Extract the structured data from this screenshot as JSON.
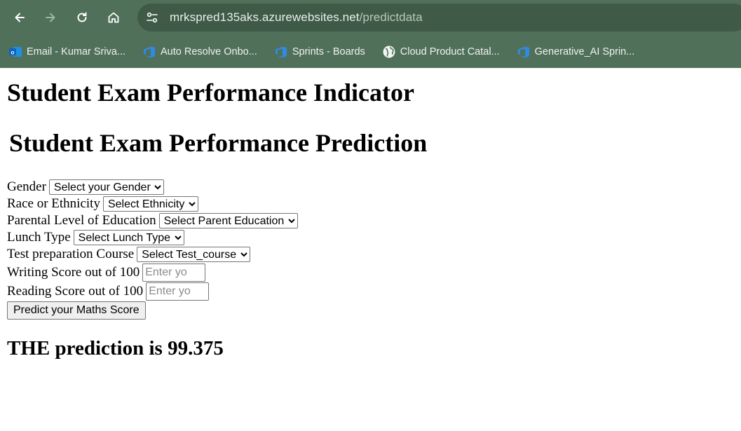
{
  "browser": {
    "url_host": "mrkspred135aks.azurewebsites.net",
    "url_path": "/predictdata",
    "nav_icons": [
      "back-icon",
      "forward-icon",
      "reload-icon",
      "home-icon"
    ],
    "bookmarks": [
      {
        "label": "Email - Kumar Sriva...",
        "icon": "outlook-icon"
      },
      {
        "label": "Auto Resolve Onbo...",
        "icon": "azure-devops-icon"
      },
      {
        "label": "Sprints - Boards",
        "icon": "azure-devops-icon"
      },
      {
        "label": "Cloud Product Catal...",
        "icon": "globe-icon"
      },
      {
        "label": "Generative_AI Sprin...",
        "icon": "azure-devops-icon"
      }
    ],
    "chrome_color": "#51705a"
  },
  "page": {
    "title1": "Student Exam Performance Indicator",
    "title2": "Student Exam Performance Prediction",
    "form": {
      "gender_label": "Gender",
      "gender_value": "Select your Gender",
      "ethnicity_label": "Race or Ethnicity",
      "ethnicity_value": "Select Ethnicity",
      "parent_label": "Parental Level of Education",
      "parent_value": "Select Parent Education",
      "lunch_label": "Lunch Type",
      "lunch_value": "Select Lunch Type",
      "test_label": "Test preparation Course",
      "test_value": "Select Test_course",
      "writing_label": "Writing Score out of 100",
      "writing_placeholder": "Enter yo",
      "reading_label": "Reading Score out of 100",
      "reading_placeholder": "Enter yo",
      "submit_label": "Predict your Maths Score"
    },
    "result": "THE prediction is 99.375"
  }
}
